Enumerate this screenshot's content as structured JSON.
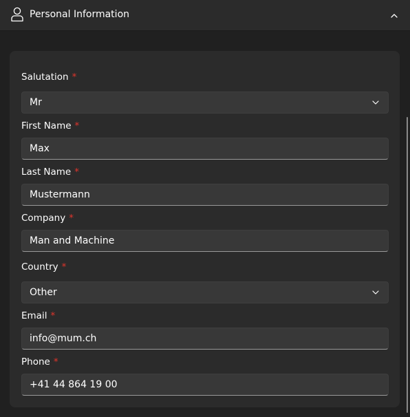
{
  "section": {
    "title": "Personal Information",
    "icon": "person-icon",
    "collapse_icon": "chevron-up-icon"
  },
  "required_marker": "*",
  "fields": {
    "salutation": {
      "label": "Salutation",
      "value": "Mr",
      "type": "select"
    },
    "first_name": {
      "label": "First Name",
      "value": "Max",
      "type": "text"
    },
    "last_name": {
      "label": "Last Name",
      "value": "Mustermann",
      "type": "text"
    },
    "company": {
      "label": "Company",
      "value": "Man and Machine",
      "type": "text"
    },
    "country": {
      "label": "Country",
      "value": "Other",
      "type": "select"
    },
    "email": {
      "label": "Email",
      "value": "info@mum.ch",
      "type": "text"
    },
    "phone": {
      "label": "Phone",
      "value": "+41 44 864 19 00",
      "type": "text"
    }
  },
  "colors": {
    "background": "#202020",
    "panel": "#2b2b2b",
    "input": "#383838",
    "required": "#e0352c"
  }
}
